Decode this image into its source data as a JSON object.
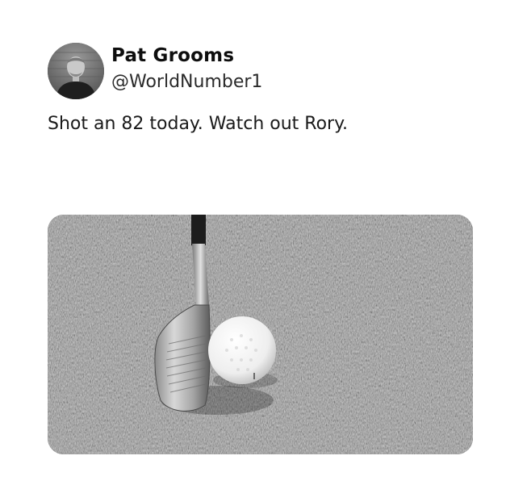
{
  "tweet": {
    "display_name": "Pat Grooms",
    "handle": "@WorldNumber1",
    "text": "Shot an 82 today. Watch out Rory."
  },
  "colors": {
    "background": "#ffffff",
    "text": "#111111"
  },
  "icons": {
    "avatar": "profile-photo",
    "media": "golf-iron-and-ball-photo"
  }
}
